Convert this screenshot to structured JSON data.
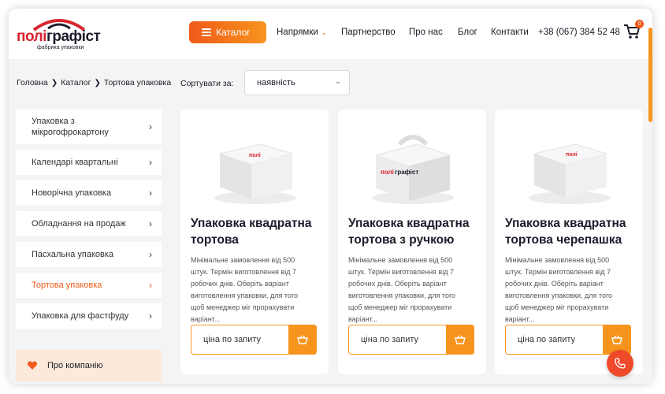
{
  "brand": {
    "name_left": "полі",
    "name_right": "графіст",
    "tagline": "фабрика упаковки",
    "accent": "#f05a1a"
  },
  "header": {
    "catalog_label": "Каталог",
    "nav": [
      "Напрямки",
      "Партнерство",
      "Про нас",
      "Блог",
      "Контакти"
    ],
    "phone": "+38 (067) 384 52 48",
    "cart_count": "0"
  },
  "breadcrumb": [
    "Головна",
    "Каталог",
    "Тортова упаковка"
  ],
  "sort": {
    "label": "Сортувати за:",
    "value": "наявність"
  },
  "sidebar": {
    "items": [
      {
        "label": "Упаковка з мікрогофрокартону"
      },
      {
        "label": "Календарі квартальні"
      },
      {
        "label": "Новорічна упаковка"
      },
      {
        "label": "Обладнання на продаж"
      },
      {
        "label": "Пасхальна упаковка"
      },
      {
        "label": "Тортова упаковка",
        "active": true
      },
      {
        "label": "Упаковка для фастфуду"
      }
    ],
    "about_label": "Про компанію"
  },
  "products": [
    {
      "title": "Упаковка квадратна тортова",
      "description": "Мінімальне замовлення від 500 штук. Термін виготовлення від 7 робочих днів. Оберіть варіант виготовлення упаковки, для того щоб менеджер міг прорахувати варіант...",
      "price_label": "ціна по запиту"
    },
    {
      "title": "Упаковка квадратна тортова з ручкою",
      "description": "Мінімальне замовлення від 500 штук. Термін виготовлення від 7 робочих днів. Оберіть варіант виготовлення упаковки, для того щоб менеджер міг прорахувати варіант...",
      "price_label": "ціна по запиту"
    },
    {
      "title": "Упаковка квадратна тортова черепашка",
      "description": "Мінімальне замовлення від 500 штук. Термін виготовлення від 7 робочих днів. Оберіть варіант виготовлення упаковки, для того щоб менеджер міг прорахувати варіант...",
      "price_label": "ціна по запиту"
    }
  ]
}
